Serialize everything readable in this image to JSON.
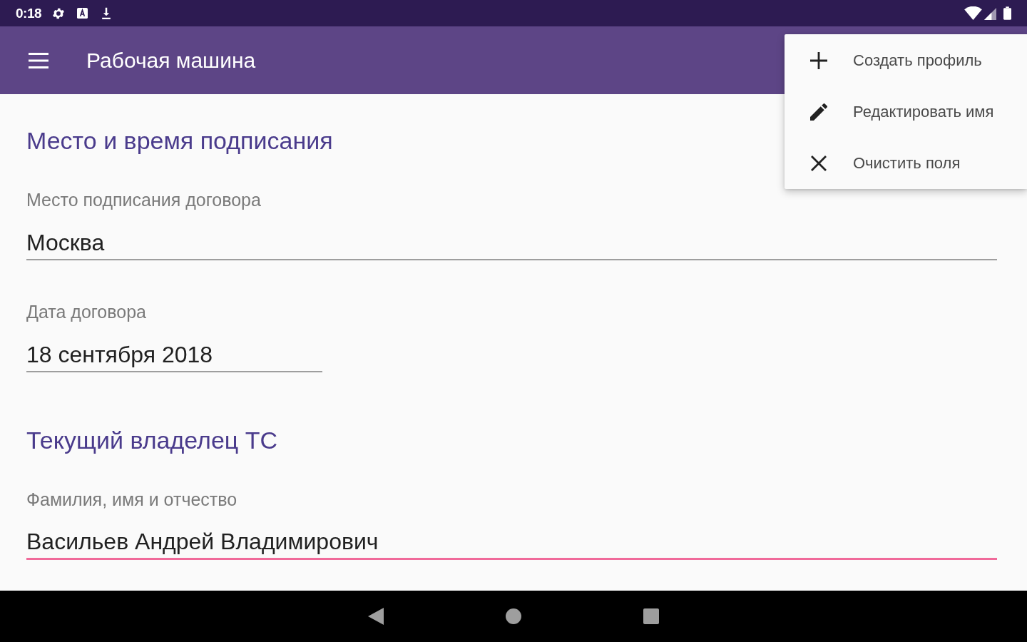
{
  "status_bar": {
    "time": "0:18"
  },
  "app_bar": {
    "title": "Рабочая машина"
  },
  "sections": [
    {
      "title": "Место и время подписания",
      "fields": [
        {
          "kind": "text",
          "label": "Место подписания договора",
          "value": "Москва",
          "focused": false
        },
        {
          "kind": "date",
          "label": "Дата договора",
          "value": "18 сентября 2018",
          "focused": false
        }
      ]
    },
    {
      "title": "Текущий владелец ТС",
      "fields": [
        {
          "kind": "text",
          "label": "Фамилия, имя и отчество",
          "value": "Васильев Андрей Владимирович",
          "focused": true
        }
      ]
    }
  ],
  "menu": {
    "items": [
      {
        "kind": "add",
        "label": "Создать профиль"
      },
      {
        "kind": "edit",
        "label": "Редактировать имя"
      },
      {
        "kind": "clear",
        "label": "Очистить поля"
      }
    ]
  }
}
